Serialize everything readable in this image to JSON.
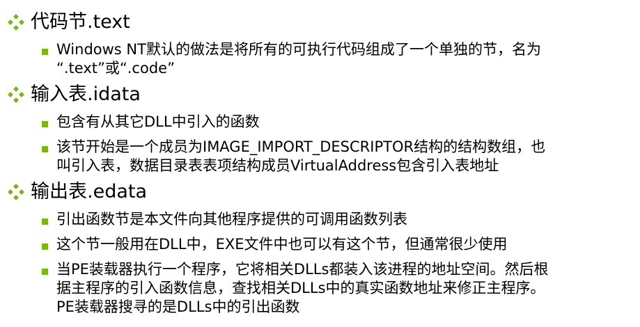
{
  "colors": {
    "accent_green": "#7cb518",
    "text": "#000000",
    "background": "#ffffff"
  },
  "icons": {
    "section_marker": "four-diamond-icon",
    "bullet_marker": "square-bullet-icon"
  },
  "sections": [
    {
      "title": "代码节.text",
      "bullets": [
        "Windows NT默认的做法是将所有的可执行代码组成了一个单独的节，名为\n“.text”或“.code”"
      ]
    },
    {
      "title": "输入表.idata",
      "bullets": [
        "包含有从其它DLL中引入的函数",
        "该节开始是一个成员为IMAGE_IMPORT_DESCRIPTOR结构的结构数组，也\n叫引入表，数据目录表表项结构成员VirtualAddress包含引入表地址"
      ]
    },
    {
      "title": "输出表.edata",
      "bullets": [
        "引出函数节是本文件向其他程序提供的可调用函数列表",
        "这个节一般用在DLL中，EXE文件中也可以有这个节，但通常很少使用",
        "当PE装载器执行一个程序，它将相关DLLs都装入该进程的地址空间。然后根\n据主程序的引入函数信息，查找相关DLLs中的真实函数地址来修正主程序。\nPE装载器搜寻的是DLLs中的引出函数"
      ]
    }
  ]
}
